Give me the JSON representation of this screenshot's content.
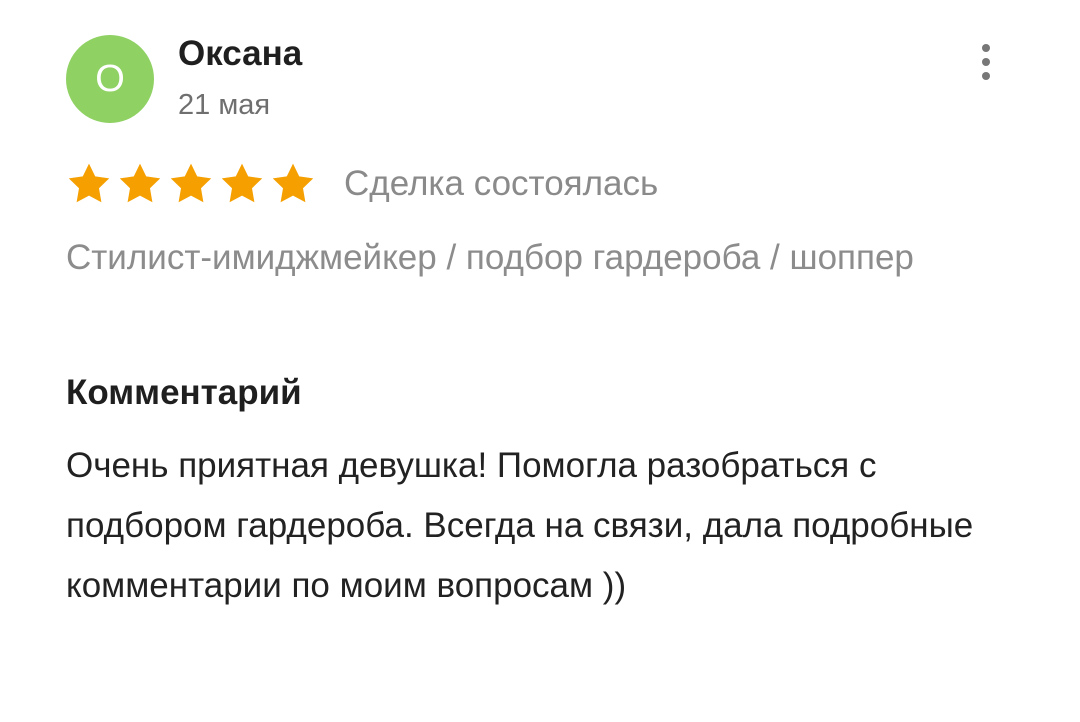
{
  "review": {
    "author": {
      "initial": "О",
      "name": "Оксана",
      "avatar_color": "#8fd163"
    },
    "date": "21 мая",
    "more_icon": "more-vertical-icon",
    "rating": {
      "value": 5,
      "max": 5,
      "star_color": "#f5a000"
    },
    "deal_status": "Сделка состоялась",
    "service": "Стилист-имиджмейкер / подбор гардероба / шоппер",
    "comment_heading": "Комментарий",
    "comment_text": "Очень приятная девушка! Помогла разобраться с подбором гардероба. Всегда на связи, дала подробные комментарии по моим вопросам ))"
  }
}
